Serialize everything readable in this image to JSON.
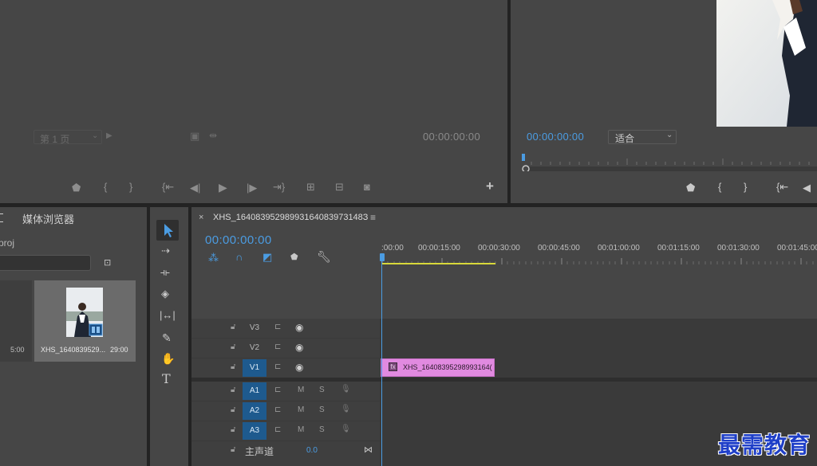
{
  "source_monitor": {
    "page_select": "第 1 页",
    "timecode": "00:00:00:00"
  },
  "program_monitor": {
    "timecode": "00:00:00:00",
    "fit_select": "适合"
  },
  "project_panel": {
    "tab_label": "媒体浏览器",
    "project_name_partial": "proj",
    "items": [
      {
        "name": "",
        "duration": "5:00"
      },
      {
        "name": "XHS_1640839529...",
        "duration": "29:00"
      }
    ]
  },
  "timeline": {
    "sequence_name": "XHS_16408395298993164083973148З",
    "timecode": "00:00:00:00",
    "ruler_labels": [
      ":00:00",
      "00:00:15:00",
      "00:00:30:00",
      "00:00:45:00",
      "00:01:00:00",
      "00:01:15:00",
      "00:01:30:00",
      "00:01:45:00"
    ],
    "video_tracks": [
      "V3",
      "V2",
      "V1"
    ],
    "audio_tracks": [
      "A1",
      "A2",
      "A3"
    ],
    "audio_buttons": {
      "mute": "M",
      "solo": "S"
    },
    "master_label": "主声道",
    "master_value": "0.0",
    "clip_name": "XHS_16408395298993164(",
    "clip_color": "#e18ae0"
  },
  "watermark": "最需教育",
  "colors": {
    "accent": "#4b9ce2",
    "panel": "#464646",
    "clip": "#e18ae0",
    "track_on": "#1e5a8e",
    "work_area": "#d8d83a"
  }
}
